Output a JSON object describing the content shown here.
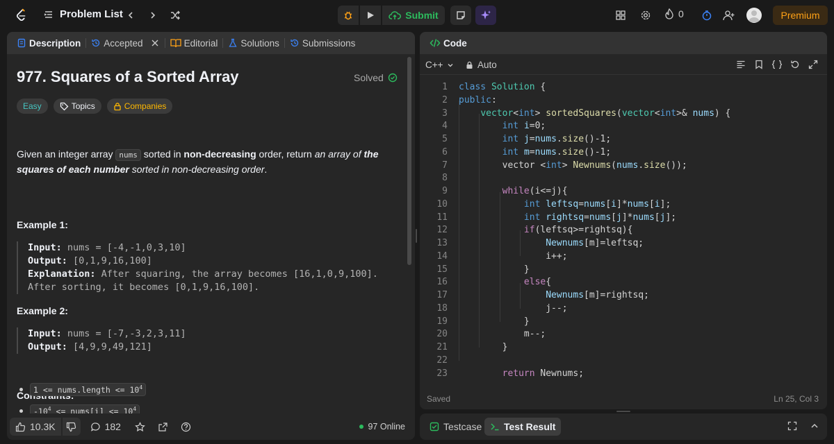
{
  "nav": {
    "problem_list": "Problem List",
    "submit": "Submit",
    "streak": "0",
    "premium": "Premium"
  },
  "left_tabs": [
    {
      "label": "Description",
      "icon": "document-icon"
    },
    {
      "label": "Accepted",
      "icon": "history-icon"
    },
    {
      "label": "Editorial",
      "icon": "book-icon"
    },
    {
      "label": "Solutions",
      "icon": "flask-icon"
    },
    {
      "label": "Submissions",
      "icon": "history-icon"
    }
  ],
  "problem": {
    "title": "977. Squares of a Sorted Array",
    "solved": "Solved",
    "difficulty": "Easy",
    "topics": "Topics",
    "companies": "Companies",
    "desc_1": "Given an integer array ",
    "desc_code": "nums",
    "desc_2": " sorted in ",
    "desc_bold": "non-decreasing",
    "desc_3": " order, return ",
    "desc_it1": "an array of ",
    "desc_bi": "the squares of each number",
    "desc_it2": " sorted in non-decreasing order",
    "desc_end": "."
  },
  "example1": {
    "heading": "Example 1:",
    "input_label": "Input:",
    "input": " nums = [-4,-1,0,3,10]",
    "output_label": "Output:",
    "output": " [0,1,9,16,100]",
    "expl_label": "Explanation:",
    "expl": " After squaring, the array becomes [16,1,0,9,100].",
    "expl2": "After sorting, it becomes [0,1,9,16,100]."
  },
  "example2": {
    "heading": "Example 2:",
    "input_label": "Input:",
    "input": " nums = [-7,-3,2,3,11]",
    "output_label": "Output:",
    "output": " [4,9,9,49,121]"
  },
  "constraints": {
    "heading": "Constraints:",
    "c1": "1 <= nums.length <= 10",
    "c1_sup": "4",
    "c2_pre": "-10",
    "c2_sup": "4",
    "c2_mid": " <= nums[i] <= 10",
    "c2_sup2": "4"
  },
  "footer": {
    "likes": "10.3K",
    "comments": "182",
    "online": "97 Online"
  },
  "editor": {
    "tab": "Code",
    "language": "C++",
    "mode": "Auto",
    "saved": "Saved",
    "cursor": "Ln 25, Col 3"
  },
  "bottom": {
    "testcase": "Testcase",
    "test_result": "Test Result"
  },
  "colors": {
    "accent_green": "#2cbb5d",
    "premium_orange": "#ffa116",
    "easy_teal": "#46c6c2",
    "companies_yellow": "#ffb800"
  }
}
